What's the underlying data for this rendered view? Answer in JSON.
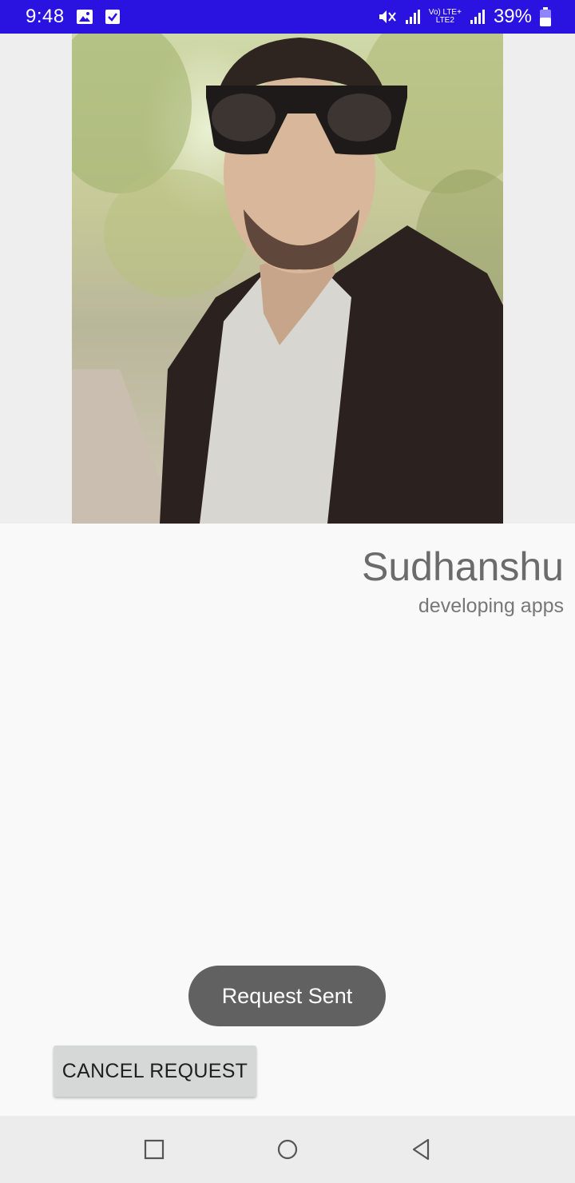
{
  "status_bar": {
    "time": "9:48",
    "battery_percent": "39%",
    "network_top": "Vo) LTE+",
    "network_bottom": "LTE2",
    "icons": [
      "gallery-icon",
      "checkbox-icon",
      "mute-icon",
      "signal-icon",
      "signal-icon",
      "battery-icon"
    ]
  },
  "profile": {
    "name": "Sudhanshu",
    "status": "developing apps"
  },
  "toast": {
    "message": "Request Sent"
  },
  "actions": {
    "cancel_label": "CANCEL REQUEST"
  },
  "nav": {
    "items": [
      "recents-button",
      "home-button",
      "back-button"
    ]
  },
  "colors": {
    "status_bar": "#2a12e0",
    "background": "#f9f9f9",
    "toast": "#616161",
    "button": "#d6d7d7",
    "nav_bar": "#ececec"
  }
}
